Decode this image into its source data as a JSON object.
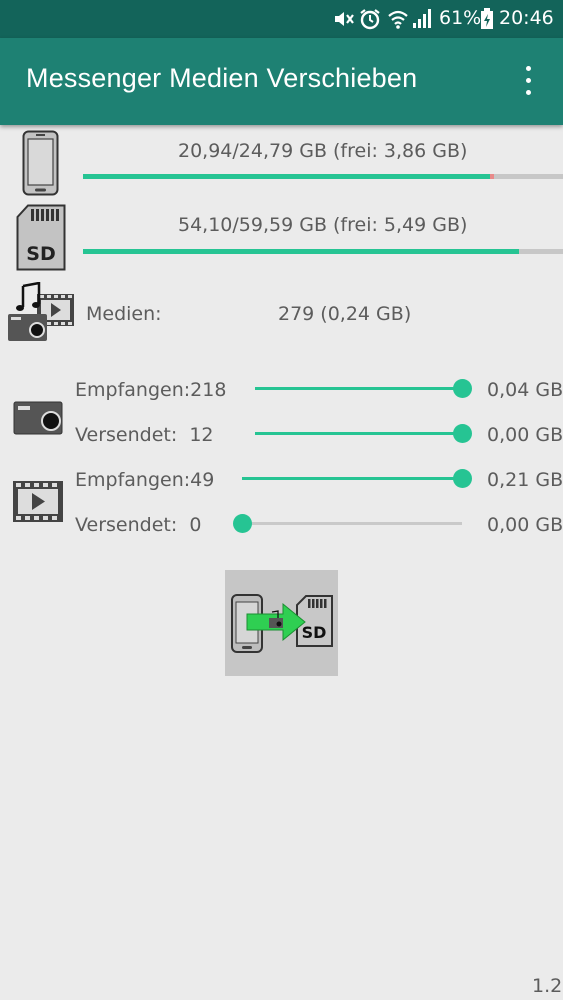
{
  "status_bar": {
    "battery_percent": "61%",
    "time": "20:46",
    "icons": [
      "mute-icon",
      "alarm-icon",
      "wifi-icon",
      "signal-icon",
      "battery-icon"
    ]
  },
  "toolbar": {
    "title": "Messenger Medien Verschieben",
    "menu_icon": "more-vert-icon"
  },
  "storage": {
    "internal": {
      "label": "20,94/24,79 GB (frei: 3,86 GB)",
      "used_fraction": 0.847
    },
    "sd": {
      "label": "54,10/59,59 GB (frei: 5,49 GB)",
      "used_fraction": 0.908
    }
  },
  "media": {
    "label": "Medien:",
    "value": "279 (0,24 GB)"
  },
  "images": {
    "received": {
      "label": "Empfangen:218",
      "size": "0,04 GB",
      "fraction": 1.0
    },
    "sent": {
      "label": "Versendet:  12",
      "size": "0,00 GB",
      "fraction": 1.0
    }
  },
  "videos": {
    "received": {
      "label": "Empfangen:49",
      "size": "0,21 GB",
      "fraction": 1.0
    },
    "sent": {
      "label": "Versendet:  0",
      "size": "0,00 GB",
      "fraction": 0.0
    }
  },
  "colors": {
    "status_bar": "#13645a",
    "toolbar": "#1e8173",
    "accent": "#26c493",
    "background": "#ebebeb"
  },
  "version": "1.2"
}
